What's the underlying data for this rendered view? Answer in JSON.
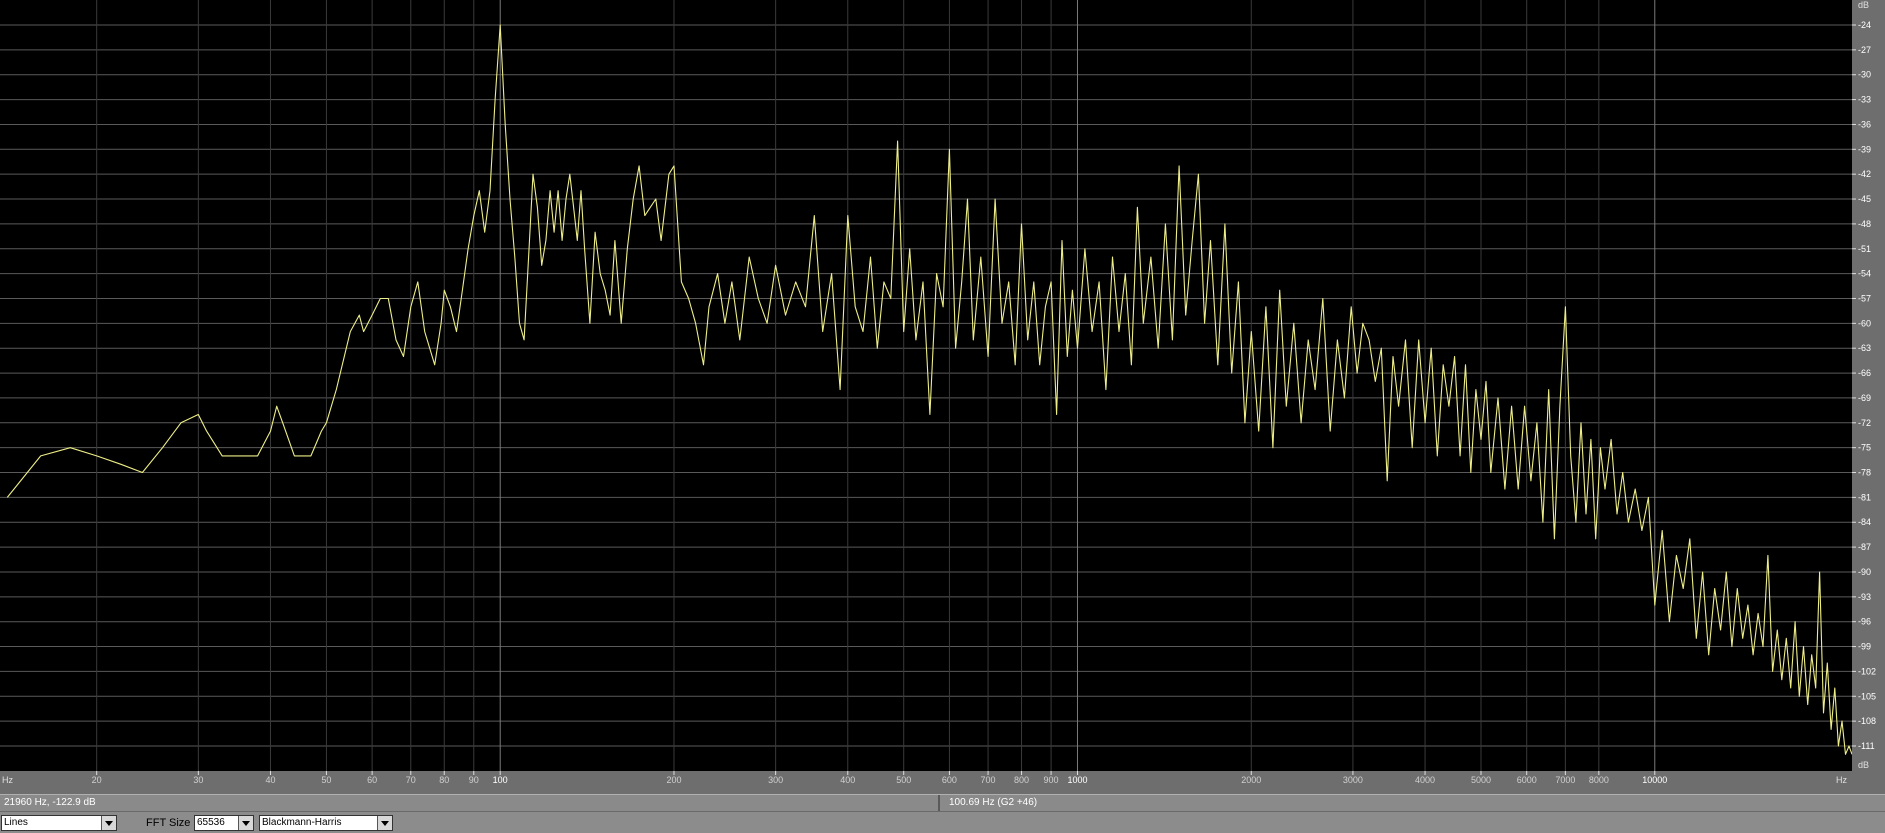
{
  "chart_data": {
    "type": "line",
    "title": "",
    "x_unit_label": "Hz",
    "y_unit_label": "dB",
    "x_scale": "log",
    "xlim": [
      13.6,
      21960
    ],
    "ylim": [
      -111,
      -24
    ],
    "grid": true,
    "x_tick_labels": [
      "20",
      "30",
      "40",
      "50",
      "60",
      "70",
      "80",
      "90",
      "100",
      "200",
      "300",
      "400",
      "500",
      "600",
      "700",
      "800",
      "900",
      "1000",
      "2000",
      "3000",
      "4000",
      "5000",
      "6000",
      "7000",
      "8000",
      "10000"
    ],
    "x_tick_values": [
      20,
      30,
      40,
      50,
      60,
      70,
      80,
      90,
      100,
      200,
      300,
      400,
      500,
      600,
      700,
      800,
      900,
      1000,
      2000,
      3000,
      4000,
      5000,
      6000,
      7000,
      8000,
      10000
    ],
    "y_ticks": [
      -24,
      -27,
      -30,
      -33,
      -36,
      -39,
      -42,
      -45,
      -48,
      -51,
      -54,
      -57,
      -60,
      -63,
      -66,
      -69,
      -72,
      -75,
      -78,
      -81,
      -84,
      -87,
      -90,
      -93,
      -96,
      -99,
      -102,
      -105,
      -108,
      -111
    ],
    "series": [
      {
        "color": "#eeee88",
        "points": [
          [
            14,
            -81
          ],
          [
            16,
            -76
          ],
          [
            18,
            -75
          ],
          [
            20,
            -76
          ],
          [
            22,
            -77
          ],
          [
            24,
            -78
          ],
          [
            26,
            -75
          ],
          [
            28,
            -72
          ],
          [
            30,
            -71
          ],
          [
            31,
            -73
          ],
          [
            33,
            -76
          ],
          [
            36,
            -76
          ],
          [
            38,
            -76
          ],
          [
            40,
            -73
          ],
          [
            41,
            -70
          ],
          [
            42,
            -72
          ],
          [
            44,
            -76
          ],
          [
            47,
            -76
          ],
          [
            49,
            -73
          ],
          [
            50,
            -72
          ],
          [
            52,
            -68
          ],
          [
            55,
            -61
          ],
          [
            57,
            -59
          ],
          [
            58,
            -61
          ],
          [
            60,
            -59
          ],
          [
            62,
            -57
          ],
          [
            64,
            -57
          ],
          [
            66,
            -62
          ],
          [
            68,
            -64
          ],
          [
            70,
            -58
          ],
          [
            72,
            -55
          ],
          [
            74,
            -61
          ],
          [
            77,
            -65
          ],
          [
            79,
            -60
          ],
          [
            80,
            -56
          ],
          [
            82,
            -58
          ],
          [
            84,
            -61
          ],
          [
            86,
            -56
          ],
          [
            88,
            -51
          ],
          [
            90,
            -47
          ],
          [
            92,
            -44
          ],
          [
            94,
            -49
          ],
          [
            96,
            -44
          ],
          [
            98,
            -33
          ],
          [
            100,
            -24
          ],
          [
            102,
            -36
          ],
          [
            104,
            -45
          ],
          [
            106,
            -52
          ],
          [
            108,
            -60
          ],
          [
            110,
            -62
          ],
          [
            112,
            -52
          ],
          [
            114,
            -42
          ],
          [
            116,
            -46
          ],
          [
            118,
            -53
          ],
          [
            120,
            -50
          ],
          [
            122,
            -44
          ],
          [
            124,
            -49
          ],
          [
            126,
            -44
          ],
          [
            128,
            -50
          ],
          [
            130,
            -45
          ],
          [
            132,
            -42
          ],
          [
            134,
            -46
          ],
          [
            136,
            -50
          ],
          [
            138,
            -44
          ],
          [
            140,
            -51
          ],
          [
            143,
            -60
          ],
          [
            146,
            -49
          ],
          [
            149,
            -54
          ],
          [
            152,
            -56
          ],
          [
            155,
            -59
          ],
          [
            158,
            -50
          ],
          [
            162,
            -60
          ],
          [
            166,
            -51
          ],
          [
            170,
            -45
          ],
          [
            174,
            -41
          ],
          [
            178,
            -47
          ],
          [
            182,
            -46
          ],
          [
            186,
            -45
          ],
          [
            190,
            -50
          ],
          [
            196,
            -42
          ],
          [
            200,
            -41
          ],
          [
            206,
            -55
          ],
          [
            212,
            -57
          ],
          [
            218,
            -60
          ],
          [
            225,
            -65
          ],
          [
            230,
            -58
          ],
          [
            238,
            -54
          ],
          [
            245,
            -60
          ],
          [
            252,
            -55
          ],
          [
            260,
            -62
          ],
          [
            270,
            -52
          ],
          [
            280,
            -57
          ],
          [
            290,
            -60
          ],
          [
            300,
            -53
          ],
          [
            312,
            -59
          ],
          [
            325,
            -55
          ],
          [
            338,
            -58
          ],
          [
            350,
            -47
          ],
          [
            362,
            -61
          ],
          [
            375,
            -54
          ],
          [
            388,
            -68
          ],
          [
            400,
            -47
          ],
          [
            412,
            -58
          ],
          [
            425,
            -61
          ],
          [
            438,
            -52
          ],
          [
            450,
            -63
          ],
          [
            462,
            -55
          ],
          [
            475,
            -57
          ],
          [
            488,
            -38
          ],
          [
            500,
            -61
          ],
          [
            512,
            -51
          ],
          [
            525,
            -62
          ],
          [
            540,
            -55
          ],
          [
            555,
            -71
          ],
          [
            570,
            -54
          ],
          [
            585,
            -58
          ],
          [
            600,
            -39
          ],
          [
            615,
            -63
          ],
          [
            630,
            -55
          ],
          [
            645,
            -45
          ],
          [
            660,
            -62
          ],
          [
            680,
            -52
          ],
          [
            700,
            -64
          ],
          [
            720,
            -45
          ],
          [
            740,
            -60
          ],
          [
            760,
            -55
          ],
          [
            780,
            -65
          ],
          [
            800,
            -48
          ],
          [
            820,
            -62
          ],
          [
            840,
            -55
          ],
          [
            860,
            -65
          ],
          [
            880,
            -58
          ],
          [
            900,
            -55
          ],
          [
            920,
            -71
          ],
          [
            940,
            -50
          ],
          [
            960,
            -64
          ],
          [
            980,
            -56
          ],
          [
            1000,
            -63
          ],
          [
            1030,
            -51
          ],
          [
            1060,
            -61
          ],
          [
            1090,
            -55
          ],
          [
            1120,
            -68
          ],
          [
            1150,
            -52
          ],
          [
            1180,
            -61
          ],
          [
            1210,
            -54
          ],
          [
            1240,
            -65
          ],
          [
            1270,
            -46
          ],
          [
            1300,
            -60
          ],
          [
            1340,
            -52
          ],
          [
            1380,
            -63
          ],
          [
            1420,
            -48
          ],
          [
            1460,
            -62
          ],
          [
            1500,
            -41
          ],
          [
            1540,
            -59
          ],
          [
            1580,
            -50
          ],
          [
            1620,
            -42
          ],
          [
            1660,
            -60
          ],
          [
            1700,
            -50
          ],
          [
            1750,
            -65
          ],
          [
            1800,
            -48
          ],
          [
            1850,
            -66
          ],
          [
            1900,
            -55
          ],
          [
            1950,
            -72
          ],
          [
            2000,
            -61
          ],
          [
            2060,
            -73
          ],
          [
            2120,
            -58
          ],
          [
            2180,
            -75
          ],
          [
            2240,
            -56
          ],
          [
            2300,
            -70
          ],
          [
            2370,
            -60
          ],
          [
            2440,
            -72
          ],
          [
            2510,
            -62
          ],
          [
            2580,
            -68
          ],
          [
            2660,
            -57
          ],
          [
            2740,
            -73
          ],
          [
            2820,
            -62
          ],
          [
            2900,
            -69
          ],
          [
            2980,
            -58
          ],
          [
            3050,
            -66
          ],
          [
            3120,
            -60
          ],
          [
            3200,
            -62
          ],
          [
            3280,
            -67
          ],
          [
            3360,
            -63
          ],
          [
            3440,
            -79
          ],
          [
            3520,
            -64
          ],
          [
            3600,
            -70
          ],
          [
            3700,
            -62
          ],
          [
            3800,
            -75
          ],
          [
            3900,
            -62
          ],
          [
            4000,
            -72
          ],
          [
            4100,
            -63
          ],
          [
            4200,
            -76
          ],
          [
            4300,
            -65
          ],
          [
            4400,
            -70
          ],
          [
            4500,
            -64
          ],
          [
            4600,
            -76
          ],
          [
            4700,
            -65
          ],
          [
            4800,
            -78
          ],
          [
            4900,
            -68
          ],
          [
            5000,
            -74
          ],
          [
            5100,
            -67
          ],
          [
            5200,
            -78
          ],
          [
            5350,
            -69
          ],
          [
            5500,
            -80
          ],
          [
            5650,
            -70
          ],
          [
            5800,
            -80
          ],
          [
            5950,
            -70
          ],
          [
            6100,
            -79
          ],
          [
            6250,
            -72
          ],
          [
            6400,
            -84
          ],
          [
            6550,
            -68
          ],
          [
            6700,
            -86
          ],
          [
            6850,
            -70
          ],
          [
            7000,
            -58
          ],
          [
            7150,
            -76
          ],
          [
            7300,
            -84
          ],
          [
            7450,
            -72
          ],
          [
            7600,
            -83
          ],
          [
            7750,
            -74
          ],
          [
            7900,
            -86
          ],
          [
            8050,
            -75
          ],
          [
            8200,
            -80
          ],
          [
            8400,
            -74
          ],
          [
            8600,
            -83
          ],
          [
            8800,
            -78
          ],
          [
            9000,
            -84
          ],
          [
            9250,
            -80
          ],
          [
            9500,
            -85
          ],
          [
            9750,
            -81
          ],
          [
            10000,
            -94
          ],
          [
            10300,
            -85
          ],
          [
            10600,
            -96
          ],
          [
            10900,
            -88
          ],
          [
            11200,
            -92
          ],
          [
            11500,
            -86
          ],
          [
            11800,
            -98
          ],
          [
            12100,
            -90
          ],
          [
            12400,
            -100
          ],
          [
            12700,
            -92
          ],
          [
            13000,
            -97
          ],
          [
            13300,
            -90
          ],
          [
            13600,
            -99
          ],
          [
            13900,
            -92
          ],
          [
            14200,
            -98
          ],
          [
            14500,
            -94
          ],
          [
            14800,
            -100
          ],
          [
            15100,
            -95
          ],
          [
            15400,
            -99
          ],
          [
            15700,
            -88
          ],
          [
            16000,
            -102
          ],
          [
            16300,
            -97
          ],
          [
            16600,
            -103
          ],
          [
            16900,
            -98
          ],
          [
            17200,
            -104
          ],
          [
            17500,
            -96
          ],
          [
            17800,
            -105
          ],
          [
            18100,
            -99
          ],
          [
            18400,
            -106
          ],
          [
            18700,
            -100
          ],
          [
            19000,
            -104
          ],
          [
            19300,
            -90
          ],
          [
            19600,
            -107
          ],
          [
            19900,
            -101
          ],
          [
            20200,
            -109
          ],
          [
            20500,
            -104
          ],
          [
            20800,
            -111
          ],
          [
            21100,
            -108
          ],
          [
            21400,
            -112
          ],
          [
            21700,
            -111
          ],
          [
            21960,
            -112
          ]
        ]
      }
    ]
  },
  "status": {
    "cursor_readout": "21960 Hz, -122.9 dB",
    "peak_readout": "100.69 Hz (G2 +46)"
  },
  "controls": {
    "display_mode": "Lines",
    "fft_size_label": "FFT Size",
    "fft_size_value": "65536",
    "window_function": "Blackmann-Harris"
  },
  "colors": {
    "background": "#000000",
    "grid_major": "#5a5a5a",
    "grid_minor": "#3a3a3a",
    "line": "#eeee88",
    "axis_panel": "#7a7a7a",
    "status_bar": "#8a8a8a"
  }
}
